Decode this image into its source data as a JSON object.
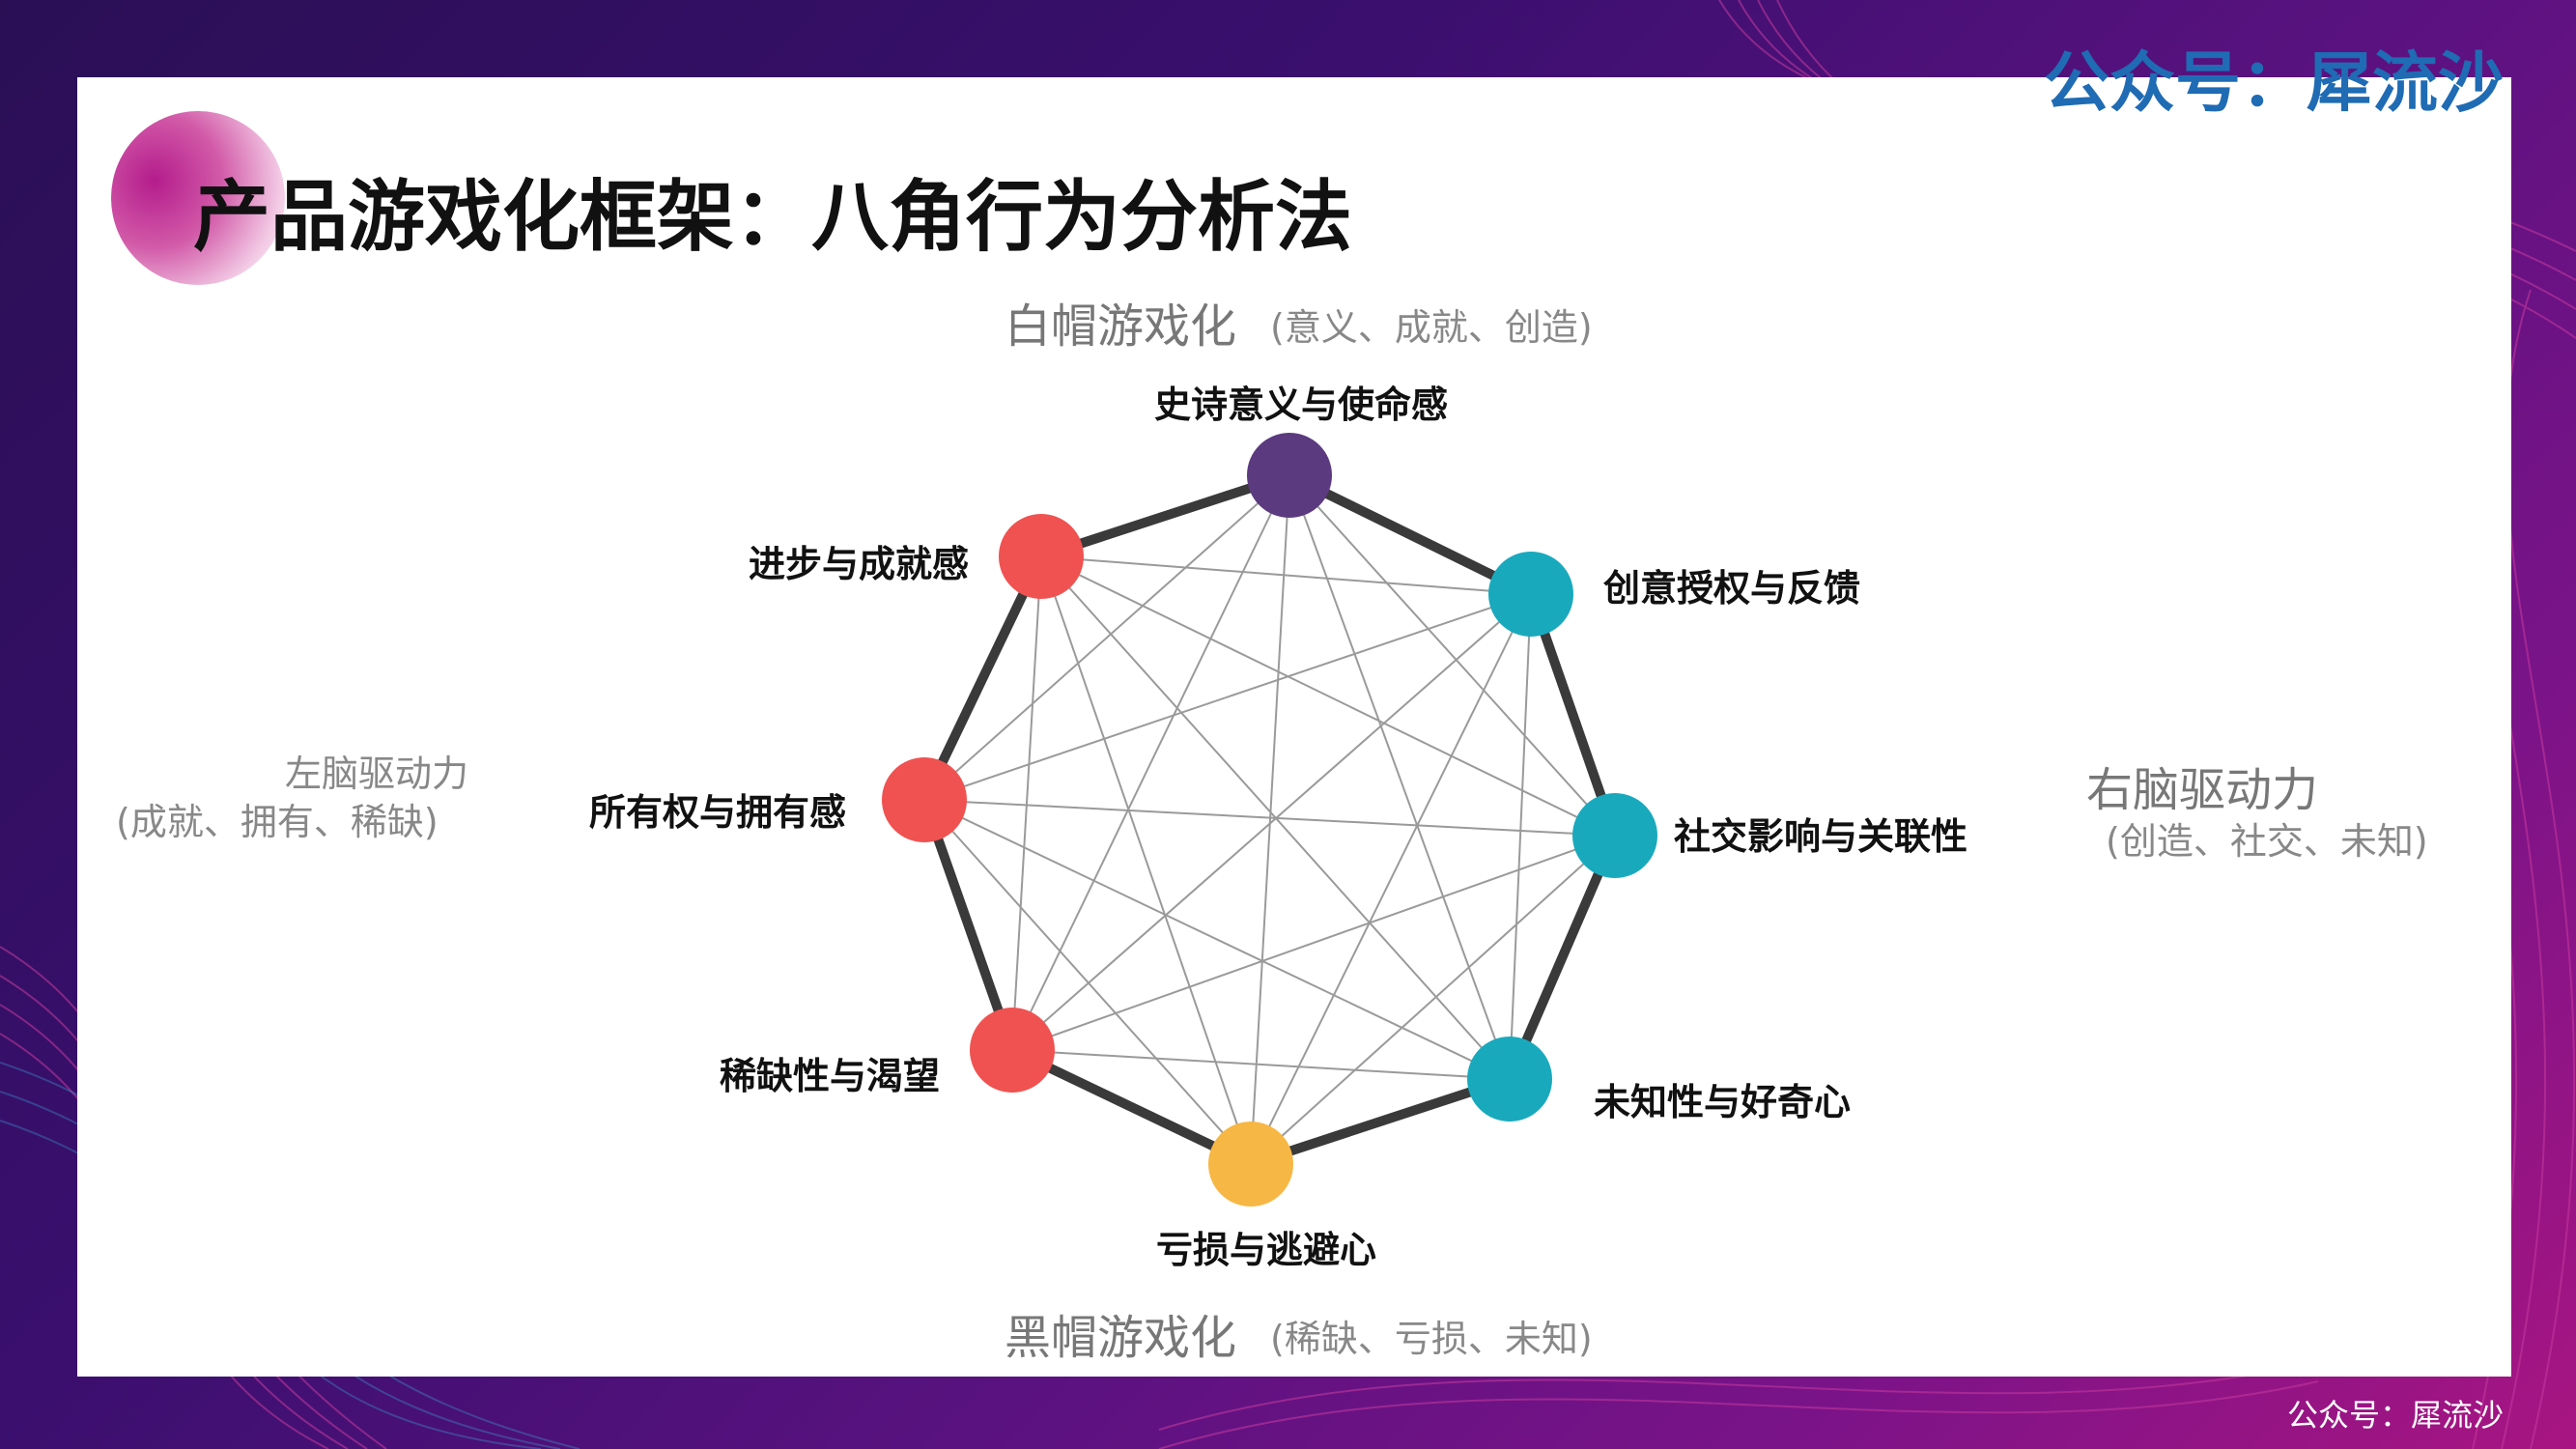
{
  "title": "产品游戏化框架：八角行为分析法",
  "watermark": "公众号：犀流沙",
  "footer": "公众号：犀流沙",
  "top_group": {
    "main": "白帽游戏化",
    "sub": "(意义、成就、创造)"
  },
  "bottom_group": {
    "main": "黑帽游戏化",
    "sub": "(稀缺、亏损、未知)"
  },
  "left_group": {
    "main": "左脑驱动力",
    "sub": "(成就、拥有、稀缺)"
  },
  "right_group": {
    "main": "右脑驱动力",
    "sub": "(创造、社交、未知)"
  },
  "nodes": [
    {
      "label": "史诗意义与使命感",
      "color": "#5b3a7f"
    },
    {
      "label": "创意授权与反馈",
      "color": "#19a9bd"
    },
    {
      "label": "社交影响与关联性",
      "color": "#19a9bd"
    },
    {
      "label": "未知性与好奇心",
      "color": "#19a9bd"
    },
    {
      "label": "亏损与逃避心",
      "color": "#f7b744"
    },
    {
      "label": "稀缺性与渴望",
      "color": "#ef5250"
    },
    {
      "label": "所有权与拥有感",
      "color": "#ef5250"
    },
    {
      "label": "进步与成就感",
      "color": "#ef5250"
    }
  ]
}
